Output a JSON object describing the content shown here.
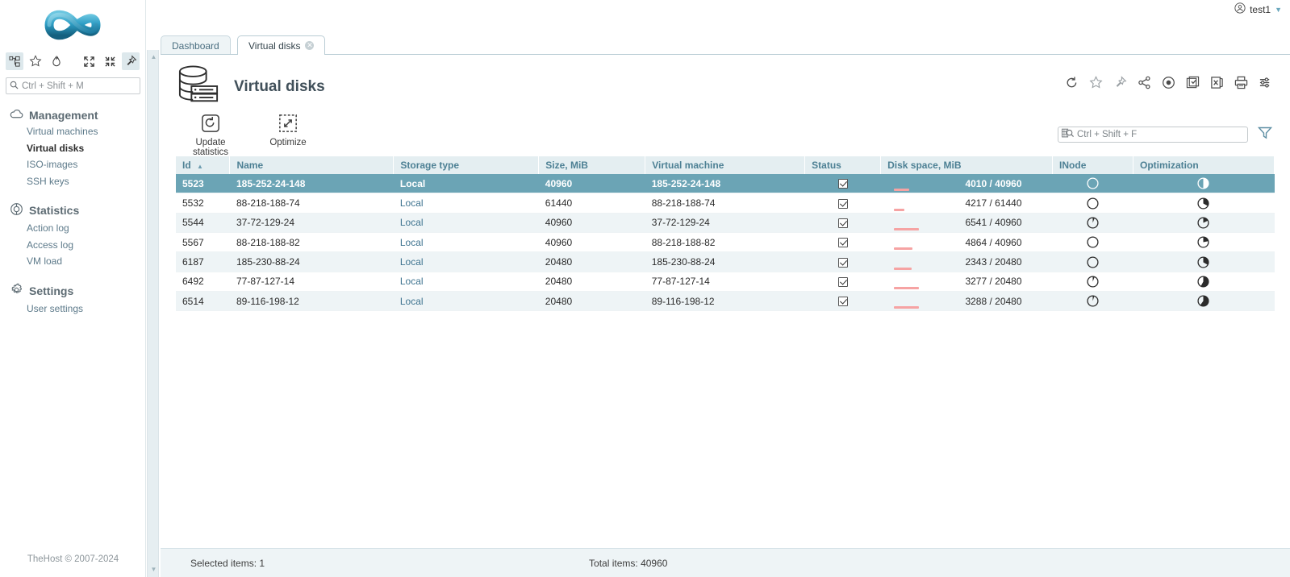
{
  "colors": {
    "accent_teal": "#6ba4b5",
    "header_bg": "#e4eef1",
    "header_text": "#4d8094",
    "link": "#3f7490",
    "progress_pink": "#f6a3a3",
    "row_alt": "#eef4f6"
  },
  "topbar": {
    "user_name": "test1",
    "user_icon": "user-circle-icon",
    "caret_icon": "chevron-down-icon"
  },
  "sidebar": {
    "logo_name": "infinity-logo",
    "toolbar_icons": [
      {
        "name": "tree-view-icon",
        "active": true
      },
      {
        "name": "star-outline-icon",
        "active": false
      },
      {
        "name": "flame-icon",
        "active": false
      },
      {
        "name": "expand-all-icon",
        "active": false
      },
      {
        "name": "collapse-all-icon",
        "active": false
      },
      {
        "name": "pin-icon",
        "active": true
      }
    ],
    "search": {
      "placeholder": "Ctrl + Shift + M",
      "icon": "search-icon"
    },
    "groups": [
      {
        "label": "Management",
        "icon": "cloud-icon",
        "items": [
          {
            "label": "Virtual machines",
            "current": false
          },
          {
            "label": "Virtual disks",
            "current": true
          },
          {
            "label": "ISO-images",
            "current": false
          },
          {
            "label": "SSH keys",
            "current": false
          }
        ]
      },
      {
        "label": "Statistics",
        "icon": "chart-pie-icon",
        "items": [
          {
            "label": "Action log",
            "current": false
          },
          {
            "label": "Access log",
            "current": false
          },
          {
            "label": "VM load",
            "current": false
          }
        ]
      },
      {
        "label": "Settings",
        "icon": "gear-icon",
        "items": [
          {
            "label": "User settings",
            "current": false
          }
        ]
      }
    ],
    "copyright": "TheHost © 2007-2024"
  },
  "tabs": [
    {
      "label": "Dashboard",
      "active": false,
      "closable": false
    },
    {
      "label": "Virtual disks",
      "active": true,
      "closable": true
    }
  ],
  "page": {
    "title": "Virtual disks",
    "icon": "database-disks-icon",
    "actions": [
      {
        "label": "Update statistics",
        "icon": "refresh-box-icon"
      },
      {
        "label": "Optimize",
        "icon": "optimize-dashed-icon"
      }
    ],
    "tools": [
      "refresh-icon",
      "star-outline-icon",
      "pin-icon",
      "share-icon",
      "record-icon",
      "checkbox-select-icon",
      "excel-export-icon",
      "print-icon",
      "settings-sliders-icon"
    ],
    "filter": {
      "placeholder": "Ctrl + Shift + F",
      "icon": "grid-search-icon",
      "funnel_icon": "filter-funnel-icon"
    }
  },
  "table": {
    "columns": [
      {
        "label": "Id",
        "sorted": "asc"
      },
      {
        "label": "Name",
        "sorted": null
      },
      {
        "label": "Storage type",
        "sorted": null
      },
      {
        "label": "Size, MiB",
        "sorted": null
      },
      {
        "label": "Virtual machine",
        "sorted": null
      },
      {
        "label": "Status",
        "sorted": null
      },
      {
        "label": "Disk space, MiB",
        "sorted": null
      },
      {
        "label": "INode",
        "sorted": null
      },
      {
        "label": "Optimization",
        "sorted": null
      }
    ],
    "rows": [
      {
        "id": "5523",
        "name": "185-252-24-148",
        "storage_type": "Local",
        "size": "40960",
        "virtual_machine": "185-252-24-148",
        "status_checked": true,
        "disk_space": "4010 / 40960",
        "disk_pct": 9.8,
        "inode_pct": 0,
        "optimization_pct": 50,
        "selected": true
      },
      {
        "id": "5532",
        "name": "88-218-188-74",
        "storage_type": "Local",
        "size": "61440",
        "virtual_machine": "88-218-188-74",
        "status_checked": true,
        "disk_space": "4217 / 61440",
        "disk_pct": 6.9,
        "inode_pct": 0,
        "optimization_pct": 33,
        "selected": false
      },
      {
        "id": "5544",
        "name": "37-72-129-24",
        "storage_type": "Local",
        "size": "40960",
        "virtual_machine": "37-72-129-24",
        "status_checked": true,
        "disk_space": "6541 / 40960",
        "disk_pct": 16.0,
        "inode_pct": 6,
        "optimization_pct": 18,
        "selected": false
      },
      {
        "id": "5567",
        "name": "88-218-188-82",
        "storage_type": "Local",
        "size": "40960",
        "virtual_machine": "88-218-188-82",
        "status_checked": true,
        "disk_space": "4864 / 40960",
        "disk_pct": 11.9,
        "inode_pct": 0,
        "optimization_pct": 22,
        "selected": false
      },
      {
        "id": "6187",
        "name": "185-230-88-24",
        "storage_type": "Local",
        "size": "20480",
        "virtual_machine": "185-230-88-24",
        "status_checked": true,
        "disk_space": "2343 / 20480",
        "disk_pct": 11.4,
        "inode_pct": 0,
        "optimization_pct": 33,
        "selected": false
      },
      {
        "id": "6492",
        "name": "77-87-127-14",
        "storage_type": "Local",
        "size": "20480",
        "virtual_machine": "77-87-127-14",
        "status_checked": true,
        "disk_space": "3277 / 20480",
        "disk_pct": 16.0,
        "inode_pct": 6,
        "optimization_pct": 58,
        "selected": false
      },
      {
        "id": "6514",
        "name": "89-116-198-12",
        "storage_type": "Local",
        "size": "20480",
        "virtual_machine": "89-116-198-12",
        "status_checked": true,
        "disk_space": "3288 / 20480",
        "disk_pct": 16.1,
        "inode_pct": 5,
        "optimization_pct": 60,
        "selected": false
      }
    ]
  },
  "statusbar": {
    "selected_items": "Selected items: 1",
    "total_items": "Total items: 40960"
  }
}
